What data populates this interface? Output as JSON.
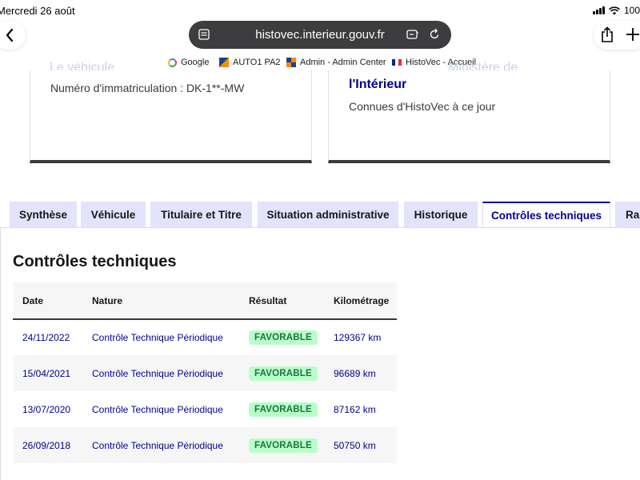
{
  "status": {
    "date": "Mercredi 26 août",
    "battery": "100"
  },
  "browser": {
    "url": "histovec.interieur.gouv.fr",
    "icons": {
      "back": "chevron-left-icon",
      "tab": "tab-list-icon",
      "translate": "page-tools-icon",
      "reload": "reload-icon",
      "share": "share-icon",
      "new_tab": "plus-icon"
    }
  },
  "bookmarks": [
    {
      "label": "Google",
      "icon": "google-icon"
    },
    {
      "label": "AUTO1 PA2",
      "icon": "auto1-icon"
    },
    {
      "label": "Admin - Admin Center",
      "icon": "admin-icon"
    },
    {
      "label": "HistoVec - Accueil",
      "icon": "flag-icon"
    }
  ],
  "cards": {
    "left": {
      "ghost_title": "Le véhicule",
      "immatriculation": "Numéro d'immatriculation : DK-1**-MW"
    },
    "right": {
      "ghost_title": "Ministère de",
      "title": "l'Intérieur",
      "subtitle": "Connues d'HistoVec à ce jour"
    }
  },
  "tabs": [
    {
      "label": "Synthèse",
      "active": false
    },
    {
      "label": "Véhicule",
      "active": false
    },
    {
      "label": "Titulaire et Titre",
      "active": false
    },
    {
      "label": "Situation administrative",
      "active": false
    },
    {
      "label": "Historique",
      "active": false
    },
    {
      "label": "Contrôles techniques",
      "active": true
    },
    {
      "label": "Rapport",
      "active": false
    }
  ],
  "section": {
    "title": "Contrôles techniques"
  },
  "table": {
    "headers": {
      "date": "Date",
      "nature": "Nature",
      "resultat": "Résultat",
      "kilometrage": "Kilométrage"
    },
    "rows": [
      {
        "date": "24/11/2022",
        "nature": "Contrôle Technique Périodique",
        "resultat": "FAVORABLE",
        "km": "129367 km"
      },
      {
        "date": "15/04/2021",
        "nature": "Contrôle Technique Périodique",
        "resultat": "FAVORABLE",
        "km": "96689 km"
      },
      {
        "date": "13/07/2020",
        "nature": "Contrôle Technique Périodique",
        "resultat": "FAVORABLE",
        "km": "87162 km"
      },
      {
        "date": "26/09/2018",
        "nature": "Contrôle Technique Périodique",
        "resultat": "FAVORABLE",
        "km": "50750 km"
      }
    ]
  },
  "colors": {
    "accent": "#000091",
    "tab_bg": "#e3e3fd",
    "badge_bg": "#b8fec9",
    "badge_text": "#18753c",
    "urlbar": "#3d3d3f"
  }
}
